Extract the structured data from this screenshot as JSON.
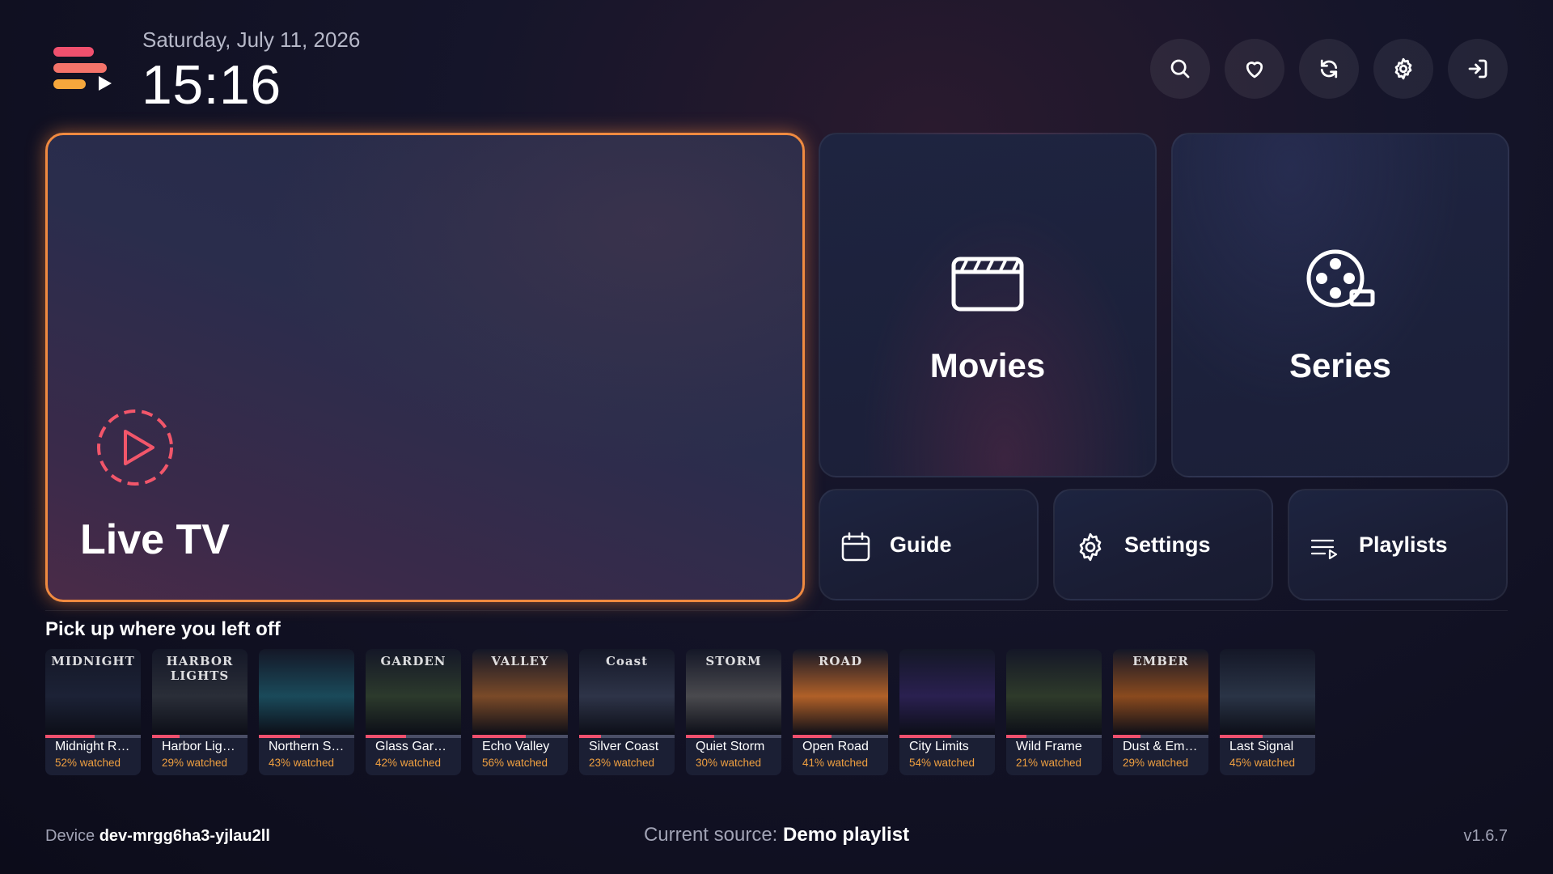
{
  "header": {
    "date": "Saturday, July 11, 2026",
    "time": "15:16"
  },
  "top_buttons": [
    {
      "icon": "search-icon"
    },
    {
      "icon": "heart-icon"
    },
    {
      "icon": "refresh-icon"
    },
    {
      "icon": "gear-icon"
    },
    {
      "icon": "sign-in-icon"
    }
  ],
  "tiles": {
    "live_tv": "Live TV",
    "movies": "Movies",
    "series": "Series",
    "guide": "Guide",
    "settings": "Settings",
    "playlists": "Playlists"
  },
  "continue": {
    "title": "Pick up where you left off",
    "items": [
      {
        "title": "Midnight R…",
        "watched": "52% watched",
        "progress": 0.52,
        "poster_text": "MIDNIGHT",
        "bg": "#1c2236"
      },
      {
        "title": "Harbor Lig…",
        "watched": "29% watched",
        "progress": 0.29,
        "poster_text": "HARBOR LIGHTS",
        "bg": "#2a2e38"
      },
      {
        "title": "Northern S…",
        "watched": "43% watched",
        "progress": 0.43,
        "poster_text": "",
        "bg": "#1a4a5a"
      },
      {
        "title": "Glass Gar…",
        "watched": "42% watched",
        "progress": 0.42,
        "poster_text": "GARDEN",
        "bg": "#2c3a2c"
      },
      {
        "title": "Echo Valley",
        "watched": "56% watched",
        "progress": 0.56,
        "poster_text": "VALLEY",
        "bg": "#7a4a28"
      },
      {
        "title": "Silver Coast",
        "watched": "23% watched",
        "progress": 0.23,
        "poster_text": "Coast",
        "bg": "#2e3448"
      },
      {
        "title": "Quiet Storm",
        "watched": "30% watched",
        "progress": 0.3,
        "poster_text": "STORM",
        "bg": "#4a4a4e"
      },
      {
        "title": "Open Road",
        "watched": "41% watched",
        "progress": 0.41,
        "poster_text": "ROAD",
        "bg": "#b06028"
      },
      {
        "title": "City Limits",
        "watched": "54% watched",
        "progress": 0.54,
        "poster_text": "",
        "bg": "#2a2050"
      },
      {
        "title": "Wild Frame",
        "watched": "21% watched",
        "progress": 0.21,
        "poster_text": "",
        "bg": "#2e3a2a"
      },
      {
        "title": "Dust & Em…",
        "watched": "29% watched",
        "progress": 0.29,
        "poster_text": "EMBER",
        "bg": "#8a4a1e"
      },
      {
        "title": "Last Signal",
        "watched": "45% watched",
        "progress": 0.45,
        "poster_text": "",
        "bg": "#2a3446"
      }
    ]
  },
  "footer": {
    "device_label": "Device",
    "device_id": "dev-mrgg6ha3-yjlau2ll",
    "source_label": "Current source:",
    "source_value": "Demo playlist",
    "version": "v1.6.7"
  },
  "colors": {
    "accent": "#f08a40",
    "progress": "#f0506e",
    "watched_text": "#f0a040"
  }
}
